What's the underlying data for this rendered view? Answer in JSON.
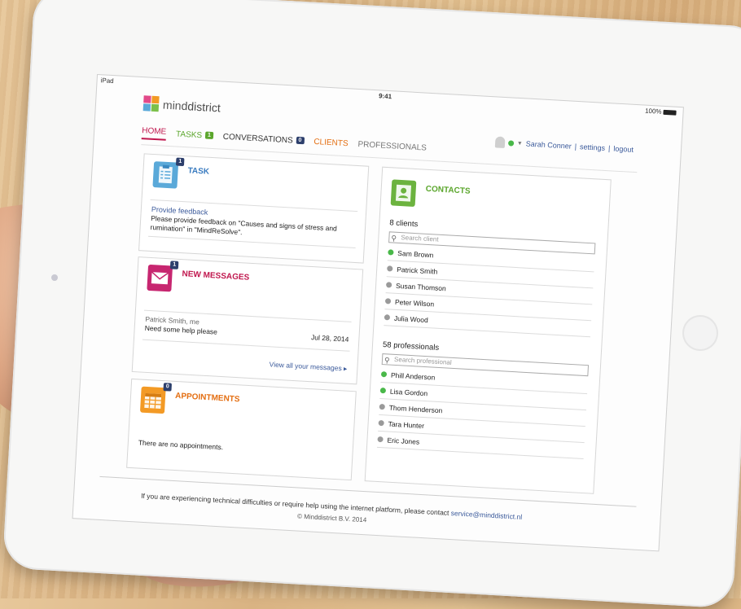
{
  "statusbar": {
    "carrier": "iPad",
    "time": "9:41",
    "battery": "100%"
  },
  "brand": {
    "name_bold": "mind",
    "name_rest": "district"
  },
  "user": {
    "name": "Sarah Conner",
    "settings": "settings",
    "logout": "logout",
    "status": "online"
  },
  "nav": {
    "home": "HOME",
    "tasks": "TASKS",
    "tasks_count": "1",
    "conversations": "CONVERSATIONS",
    "conversations_count": "0",
    "clients": "CLIENTS",
    "professionals": "PROFESSIONALS"
  },
  "task": {
    "title": "TASK",
    "count": "1",
    "link": "Provide feedback",
    "description": "Please provide feedback on \"Causes and signs of stress and rumination\" in \"MindReSolve\"."
  },
  "messages": {
    "title": "NEW MESSAGES",
    "count": "1",
    "from": "Patrick Smith, me",
    "text": "Need some help please",
    "date": "Jul 28, 2014",
    "view_all": "View all your messages ▸"
  },
  "appointments": {
    "title": "APPOINTMENTS",
    "count": "0",
    "empty_text": "There are no appointments."
  },
  "contacts": {
    "title": "CONTACTS",
    "clients_heading": "8 clients",
    "clients_search_placeholder": "Search client",
    "clients": [
      {
        "name": "Sam Brown",
        "online": true
      },
      {
        "name": "Patrick Smith",
        "online": false
      },
      {
        "name": "Susan Thomson",
        "online": false
      },
      {
        "name": "Peter Wilson",
        "online": false
      },
      {
        "name": "Julia Wood",
        "online": false
      }
    ],
    "professionals_heading": "58 professionals",
    "professionals_search_placeholder": "Search professional",
    "professionals": [
      {
        "name": "Phill Anderson",
        "online": true
      },
      {
        "name": "Lisa Gordon",
        "online": true
      },
      {
        "name": "Thom Henderson",
        "online": false
      },
      {
        "name": "Tara Hunter",
        "online": false
      },
      {
        "name": "Eric Jones",
        "online": false
      }
    ]
  },
  "footer": {
    "text": "If you are experiencing technical difficulties or require help using the internet platform, please contact ",
    "email": "service@minddistrict.nl",
    "copyright": "© Minddistrict B.V. 2014"
  },
  "colors": {
    "home": "#c0174e",
    "tasks": "#5ba62c",
    "clients": "#e46f13",
    "task_icon": "#5aa9d9",
    "msg_icon": "#c72670",
    "appt_icon": "#f39a25",
    "contacts_icon": "#6cb33f",
    "online": "#49b849",
    "offline": "#9a9a9a"
  }
}
